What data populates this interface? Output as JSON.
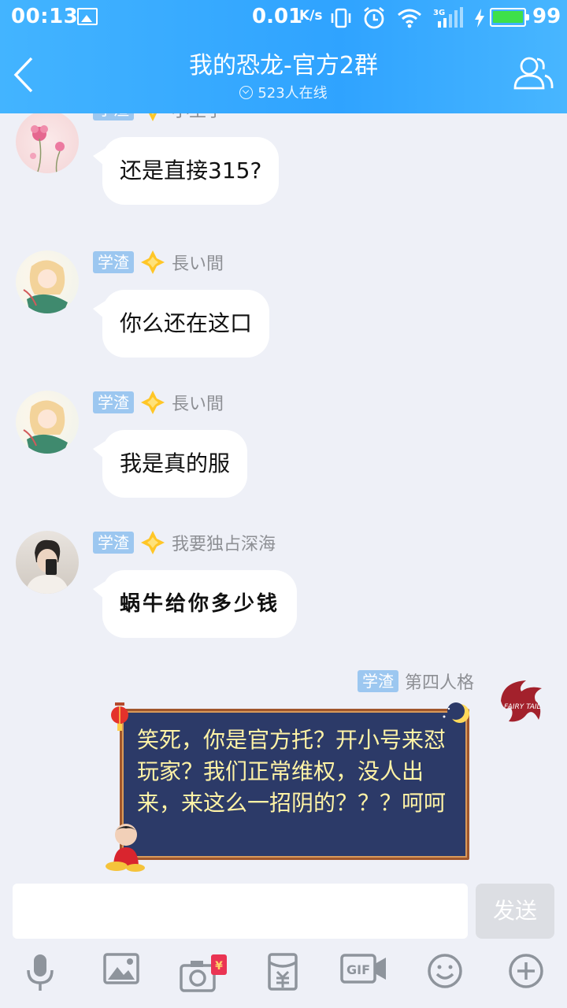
{
  "status_bar": {
    "time": "00:13",
    "speed": "0.01",
    "speed_unit": "K/s",
    "network": "3G",
    "battery": "99",
    "battery_level": 0.99
  },
  "header": {
    "title": "我的恐龙-官方2群",
    "online": "523人在线"
  },
  "messages": [
    {
      "rank": "学渣",
      "sender": "小王子",
      "text": "还是直接315?"
    },
    {
      "rank": "学渣",
      "sender": "長い間",
      "text": "你么还在这口"
    },
    {
      "rank": "学渣",
      "sender": "長い間",
      "text": "我是真的服"
    },
    {
      "rank": "学渣",
      "sender": "我要独占深海",
      "text": "蜗牛给你多少钱"
    }
  ],
  "my_message": {
    "rank": "学渣",
    "sender": "第四人格",
    "text": "笑死，你是官方托？开小号来怼玩家？我们正常维权，没人出来，来这么一招阴的？？？呵呵"
  },
  "input": {
    "placeholder": "",
    "send_label": "发送"
  },
  "toolbar": {
    "red_packet_icon_label": "¥",
    "gif_label": "GIF"
  },
  "colors": {
    "header_blue": "#2fa3ff",
    "rank_badge": "#9cc7f0",
    "bubble_bg": "#ffffff",
    "chat_bg": "#eef0f7",
    "scroll_bg": "#2c3a68",
    "scroll_text": "#fff3a6"
  },
  "icons": [
    "gallery-icon",
    "vibrate-icon",
    "alarm-icon",
    "wifi-icon",
    "signal-icon",
    "charging-icon",
    "back-icon",
    "members-icon",
    "star-icon",
    "mic-icon",
    "image-icon",
    "camera-icon",
    "red-packet-icon",
    "gif-icon",
    "emoji-icon",
    "plus-icon"
  ]
}
